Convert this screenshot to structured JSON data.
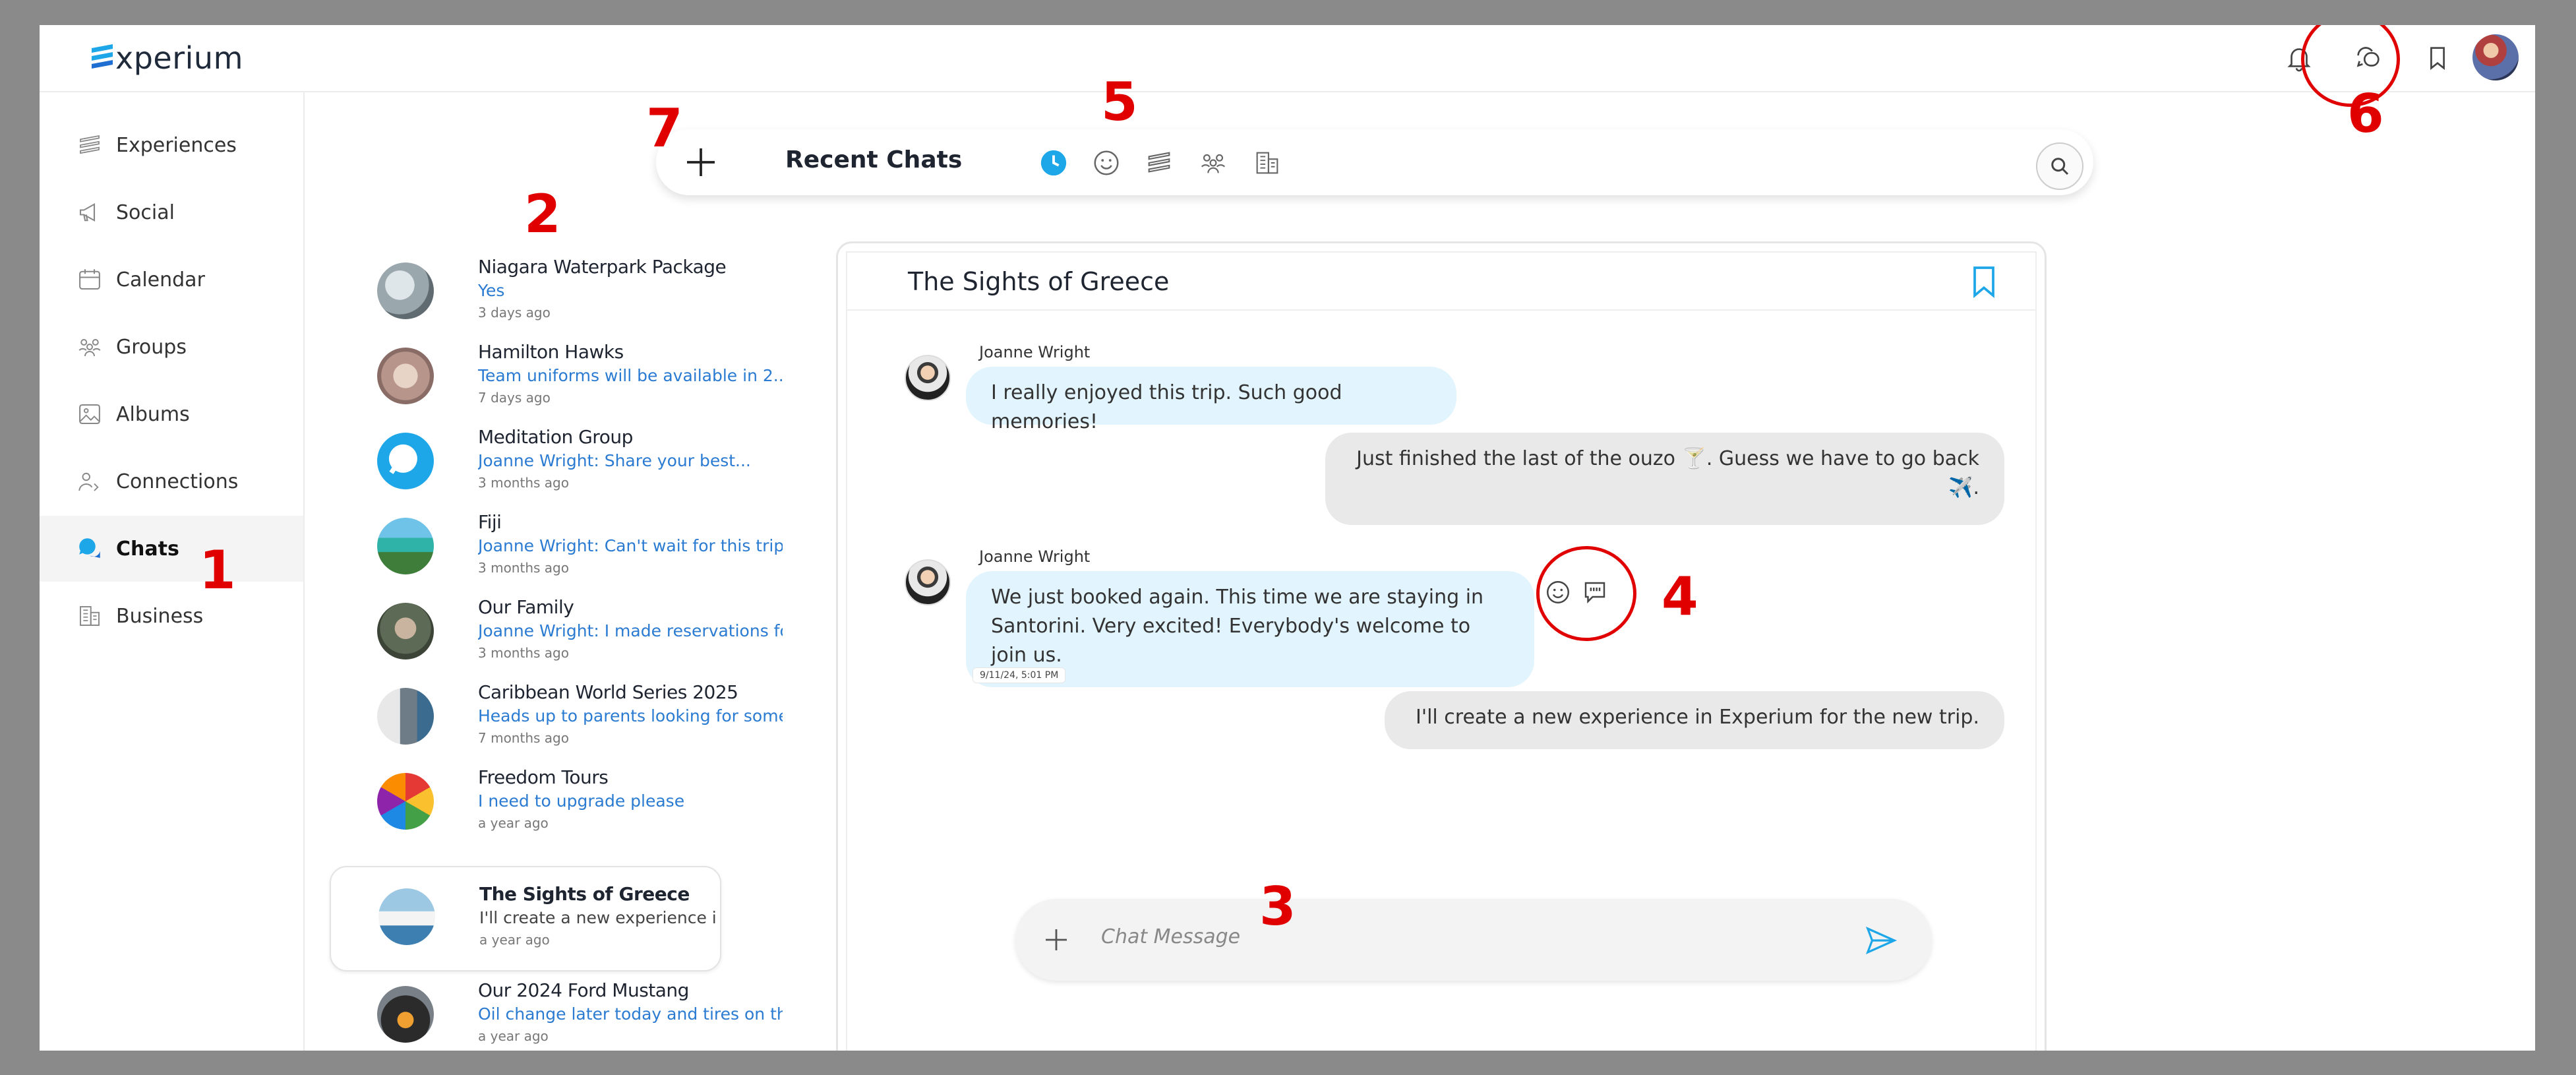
{
  "app": {
    "brand": "xperium"
  },
  "sidebar": {
    "items": [
      {
        "label": "Experiences",
        "icon": "experiences-icon"
      },
      {
        "label": "Social",
        "icon": "megaphone-icon"
      },
      {
        "label": "Calendar",
        "icon": "calendar-icon"
      },
      {
        "label": "Groups",
        "icon": "groups-icon"
      },
      {
        "label": "Albums",
        "icon": "image-icon"
      },
      {
        "label": "Connections",
        "icon": "connections-icon"
      },
      {
        "label": "Chats",
        "icon": "chats-icon",
        "active": true
      },
      {
        "label": "Business",
        "icon": "building-icon"
      }
    ]
  },
  "chats_header": {
    "title": "Recent Chats",
    "filters": [
      "clock-icon",
      "smiley-icon",
      "experiences-icon",
      "groups-icon",
      "building-icon"
    ]
  },
  "chat_list": [
    {
      "name": "Niagara Waterpark Package",
      "preview": "Yes",
      "time": "3 days ago"
    },
    {
      "name": "Hamilton Hawks",
      "preview": "Team uniforms will be available in 2...",
      "time": "7 days ago"
    },
    {
      "name": "Meditation Group",
      "preview": "Joanne Wright: Share your best...",
      "time": "3 months ago"
    },
    {
      "name": "Fiji",
      "preview": "Joanne Wright: Can't wait for this trip....",
      "time": "3 months ago"
    },
    {
      "name": "Our Family",
      "preview": "Joanne Wright: I made reservations for.",
      "time": "3 months ago"
    },
    {
      "name": "Caribbean World Series 2025",
      "preview": "Heads up to parents looking for someth",
      "time": "7 months ago"
    },
    {
      "name": "Freedom Tours",
      "preview": "I need to upgrade please",
      "time": "a year ago"
    },
    {
      "name": "The Sights of Greece",
      "preview": "I'll create a new experience in...",
      "time": "a year ago",
      "selected": true
    },
    {
      "name": "Our 2024 Ford Mustang",
      "preview": "Oil change later today and tires on the.",
      "time": "a year ago"
    }
  ],
  "conversation": {
    "title": "The Sights of Greece",
    "messages": [
      {
        "sender": "Joanne Wright",
        "text": "I really enjoyed this trip. Such good memories!",
        "direction": "in"
      },
      {
        "text": "Just finished the last of the ouzo 🍸. Guess we have to go back ✈️.",
        "direction": "out"
      },
      {
        "sender": "Joanne Wright",
        "text": "We just booked again. This time we are staying in Santorini. Very excited! Everybody's welcome to join us.",
        "direction": "in",
        "timestamp": "9/11/24, 5:01 PM"
      },
      {
        "text": "I'll create a new experience in Experium for the new trip.",
        "direction": "out"
      }
    ],
    "composer_placeholder": "Chat Message"
  },
  "annotations": [
    "1",
    "2",
    "3",
    "4",
    "5",
    "6",
    "7"
  ],
  "colors": {
    "accent": "#1ea7e8",
    "annotation": "#e00000",
    "link_blue": "#2a7bd1"
  }
}
